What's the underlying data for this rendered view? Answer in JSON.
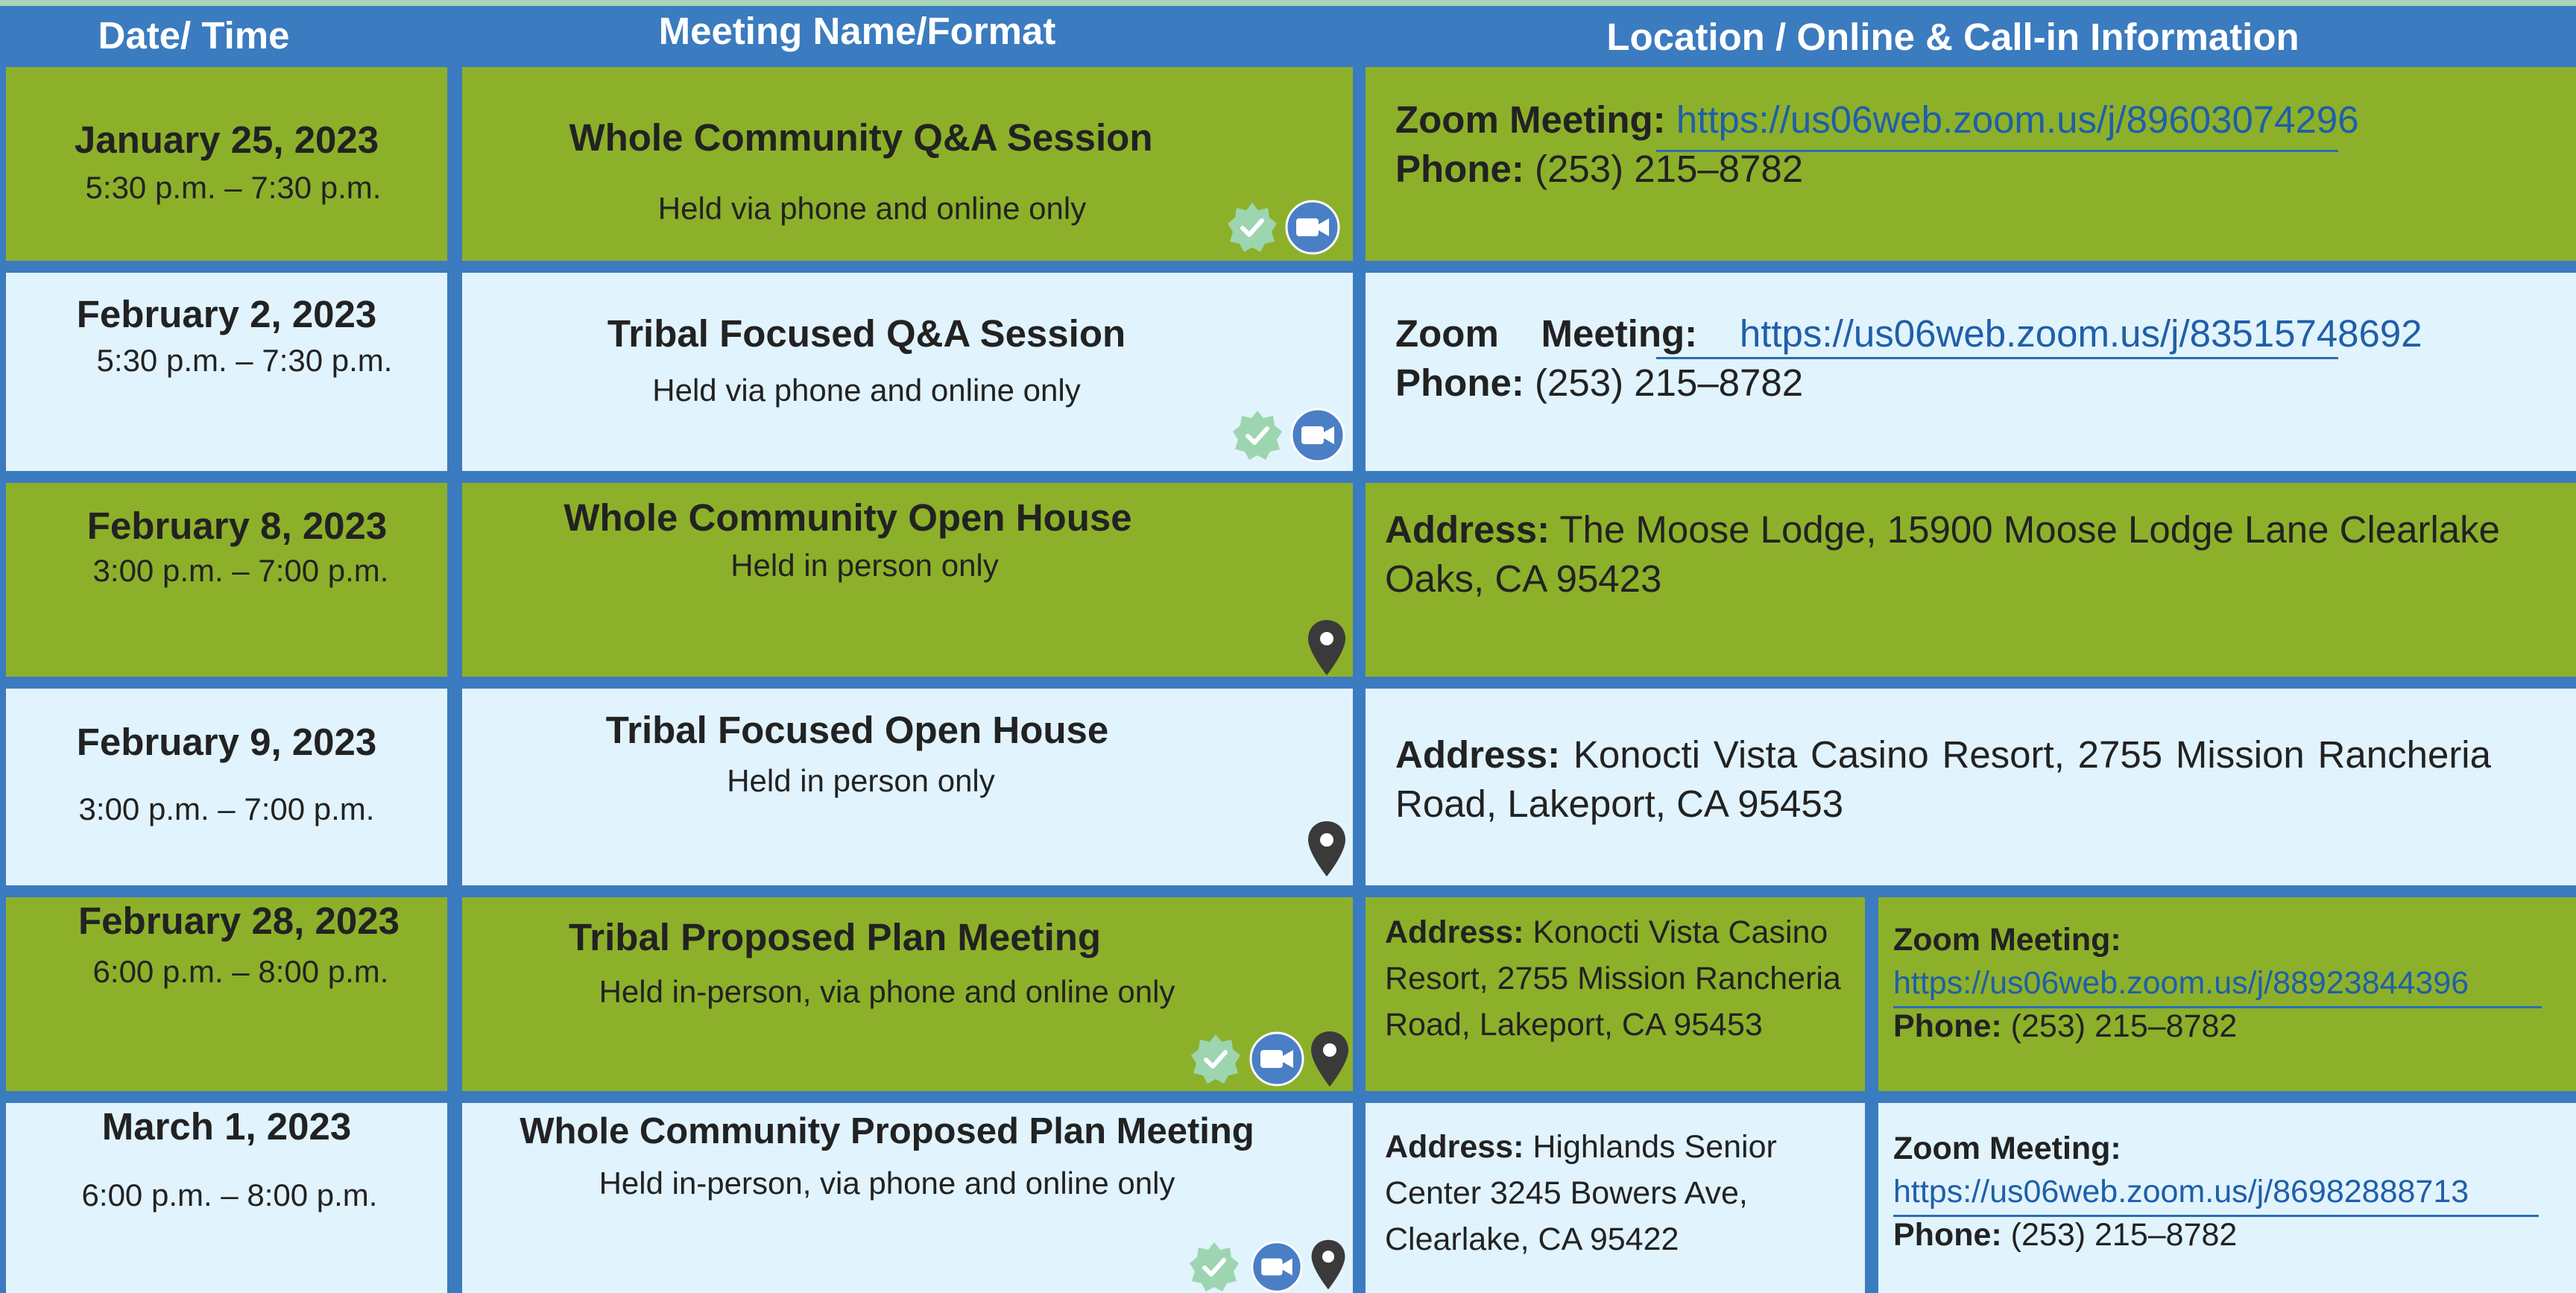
{
  "headers": {
    "date_time": "Date/ Time",
    "meeting": "Meeting Name/Format",
    "location": "Location / Online & Call-in Information"
  },
  "labels": {
    "zoom": "Zoom Meeting:",
    "phone": "Phone:",
    "address": "Address:"
  },
  "meetings": [
    {
      "date": "January 25, 2023",
      "time": "5:30 p.m. – 7:30 p.m.",
      "name": "Whole Community Q&A Session",
      "format": "Held via phone and online only",
      "zoom": "https://us06web.zoom.us/j/89603074296",
      "phone": "(253) 215–8782",
      "icons": [
        "badge-check-icon",
        "video-camera-icon"
      ]
    },
    {
      "date": "February 2, 2023",
      "time": "5:30 p.m. – 7:30 p.m.",
      "name": "Tribal Focused Q&A Session",
      "format": "Held via phone and online only",
      "zoom_label": "Zoom    Meeting:",
      "zoom": "https://us06web.zoom.us/j/83515748692",
      "phone": "(253) 215–8782",
      "icons": [
        "badge-check-icon",
        "video-camera-icon"
      ]
    },
    {
      "date": "February 8, 2023",
      "time": "3:00 p.m. – 7:00 p.m.",
      "name": "Whole Community Open House",
      "format": "Held in person only",
      "address": "The Moose Lodge, 15900 Moose Lodge Lane Clearlake Oaks, CA 95423",
      "icons": [
        "map-pin-icon"
      ]
    },
    {
      "date": "February 9, 2023",
      "time": "3:00 p.m. – 7:00 p.m.",
      "name": "Tribal Focused Open House",
      "format": "Held in person only",
      "address": "Konocti Vista Casino Resort, 2755 Mission Rancheria Road, Lakeport, CA 95453",
      "icons": [
        "map-pin-icon"
      ]
    },
    {
      "date": "February 28, 2023",
      "time": "6:00 p.m. – 8:00 p.m.",
      "name": "Tribal Proposed Plan Meeting",
      "format": "Held in-person, via phone and online only",
      "address_lines": [
        "Konocti Vista Casino",
        "Resort, 2755 Mission Rancheria",
        "Road, Lakeport, CA 95453"
      ],
      "zoom": "https://us06web.zoom.us/j/88923844396",
      "phone": "(253) 215–8782",
      "icons": [
        "badge-check-icon",
        "video-camera-icon",
        "map-pin-icon"
      ]
    },
    {
      "date": "March 1, 2023",
      "time": "6:00 p.m. – 8:00 p.m.",
      "name": "Whole Community Proposed Plan Meeting",
      "format": "Held in-person, via phone and online only",
      "address_lines": [
        "Highlands Senior",
        "Center 3245 Bowers Ave,",
        "Clearlake, CA 95422"
      ],
      "zoom": "https://us06web.zoom.us/j/86982888713",
      "phone": "(253) 215–8782",
      "icons": [
        "badge-check-icon",
        "video-camera-icon",
        "map-pin-icon"
      ]
    }
  ],
  "colors": {
    "border": "#3b7bbf",
    "row_green": "#8db02a",
    "row_light": "#e1f3fd",
    "link": "#1f5fa8"
  }
}
